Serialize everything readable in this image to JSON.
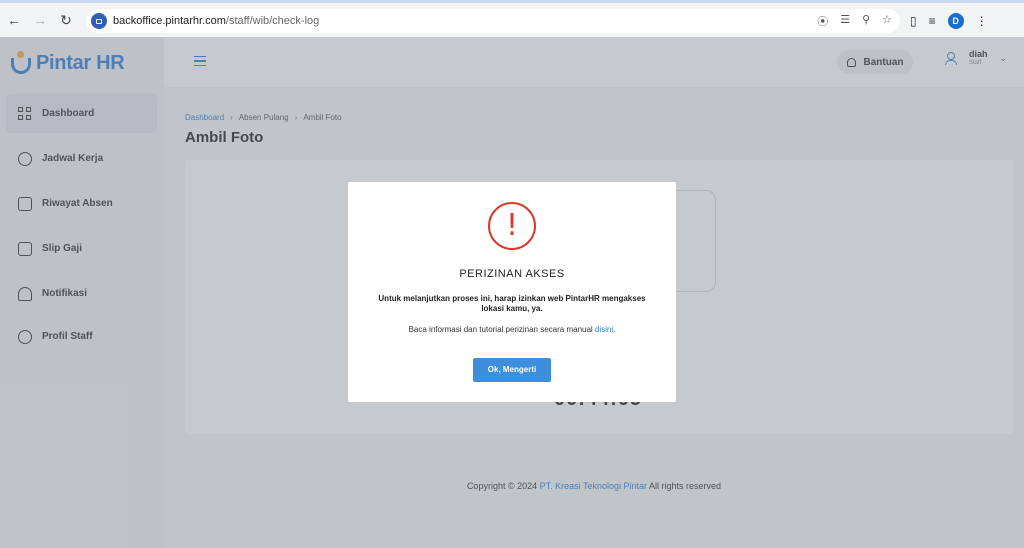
{
  "browser": {
    "url_host": "backoffice.pintarhr.com",
    "url_path": "/staff/wib/check-log",
    "profile_initial": "D"
  },
  "brand": {
    "name": "Pintar HR",
    "color": "#2d7fd3"
  },
  "sidebar": {
    "items": [
      {
        "label": "Dashboard",
        "icon": "dashboard-grid-icon",
        "active": true
      },
      {
        "label": "Jadwal Kerja",
        "icon": "alarm-clock-icon"
      },
      {
        "label": "Riwayat Absen",
        "icon": "calendar-check-icon"
      },
      {
        "label": "Slip Gaji",
        "icon": "receipt-icon"
      },
      {
        "label": "Notifikasi",
        "icon": "bell-icon"
      },
      {
        "label": "Profil Staff",
        "icon": "user-circle-icon"
      }
    ]
  },
  "topbar": {
    "help_label": "Bantuan",
    "user_name": "diah",
    "user_role": "Staff"
  },
  "breadcrumb": [
    "Dashboard",
    "Absen Pulang",
    "Ambil Foto"
  ],
  "page": {
    "title": "Ambil Foto",
    "clock": "00:44:05"
  },
  "footer": {
    "prefix": "Copyright © 2024 ",
    "company": "PT. Kreasi Teknologi Pintar",
    "suffix": " All rights reserved"
  },
  "modal": {
    "icon": "exclamation-icon",
    "title": "PERIZINAN AKSES",
    "message": "Untuk melanjutkan proses ini, harap izinkan web PintarHR mengakses lokasi kamu, ya.",
    "info_prefix": "Baca informasi dan tutorial perizinan secara manual ",
    "info_link": "disini",
    "info_suffix": ".",
    "ok_label": "Ok, Mengerti",
    "alert_color": "#d9382c",
    "button_color": "#3d8fdb"
  }
}
